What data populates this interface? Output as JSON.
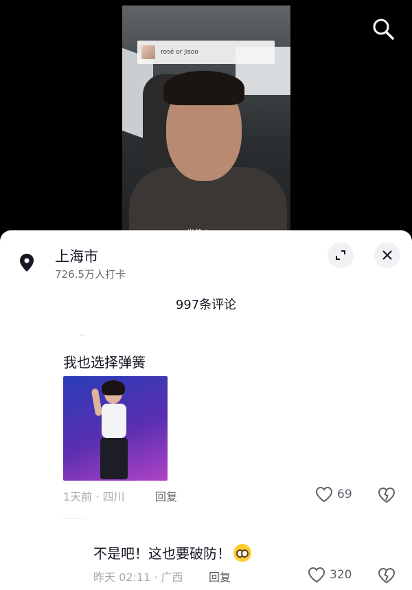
{
  "video": {
    "question": "rosé or jisoo",
    "caption": "当然 jisoo"
  },
  "location": {
    "name": "上海市",
    "checkins": "726.5万人打卡"
  },
  "comments_count": "997条评论",
  "comments": [
    {
      "text": "我也选择弹簧",
      "time": "1天前 · 四川",
      "reply_label": "回复",
      "likes": "69"
    },
    {
      "text": "不是吧！这也要破防！",
      "time": "昨天 02:11 · 广西",
      "reply_label": "回复",
      "likes": "320"
    }
  ],
  "icons": {
    "search": "search-icon",
    "location": "location-pin-icon",
    "expand": "expand-icon",
    "close": "close-icon",
    "like": "heart-icon",
    "dislike": "broken-heart-icon"
  }
}
